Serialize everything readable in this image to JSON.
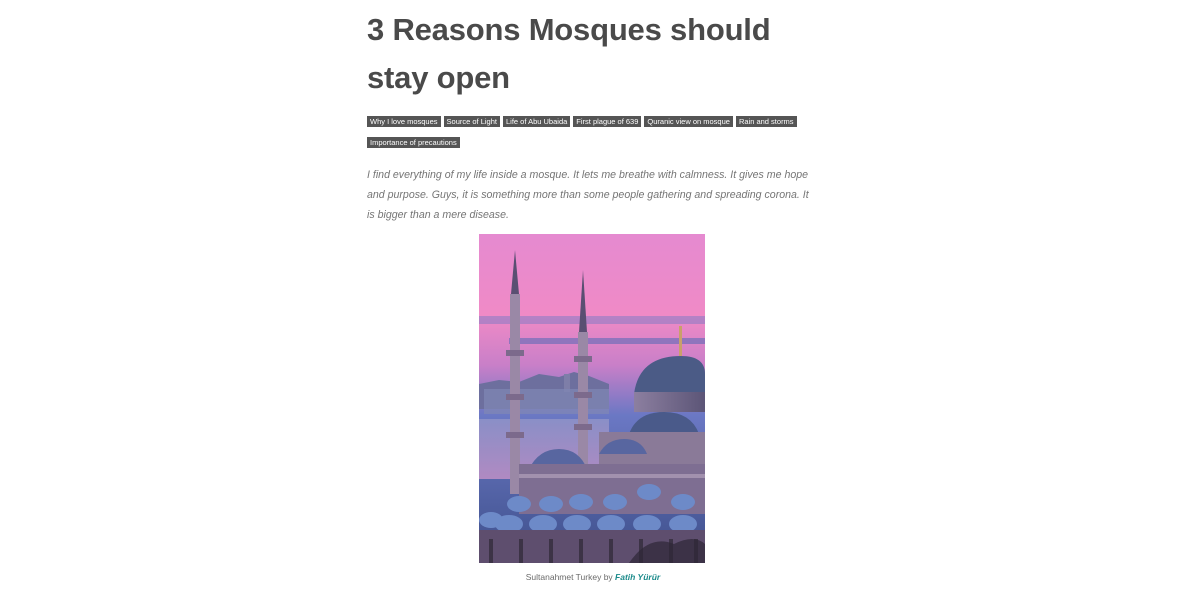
{
  "article": {
    "title": "3 Reasons Mosques should stay open",
    "tags": [
      "Why I love mosques",
      "Source of Light",
      "Life of Abu Ubaida",
      "First plague of 639",
      "Quranic view on mosque",
      "Rain and storms",
      "Importance of precautions"
    ],
    "intro": "I find everything of my life inside a mosque. It lets me breathe with calmness. It gives me hope and purpose. Guys, it is something more than some people gathering and spreading corona. It is bigger than a mere disease.",
    "image": {
      "caption_prefix": "Sultanahmet Turkey by ",
      "caption_author": "Fatih Yürür"
    }
  },
  "colors": {
    "title": "#4a4a4a",
    "tag_bg": "#555555",
    "tag_text": "#ffffff",
    "intro_text": "#757575",
    "link": "#1a8a8a"
  }
}
